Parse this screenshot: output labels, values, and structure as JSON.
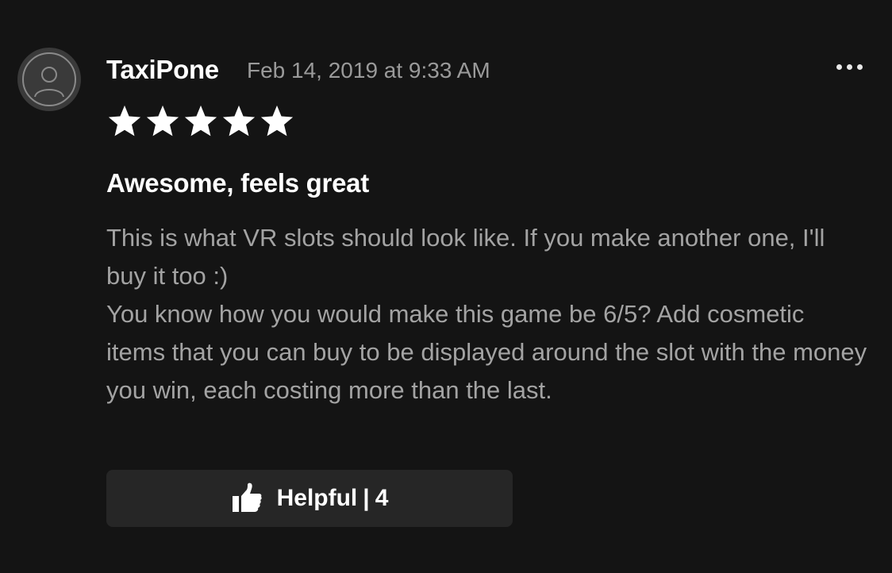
{
  "review": {
    "author": "TaxiPone",
    "timestamp": "Feb 14, 2019 at 9:33 AM",
    "rating": 5,
    "rating_max": 5,
    "title": "Awesome, feels great",
    "body": "This is what VR slots should look like. If you make another one, I'll buy it too :)\nYou know how you would make this game be 6/5? Add cosmetic items that you can buy to be displayed around the slot with the money you win, each costing more than the last."
  },
  "actions": {
    "more_icon": "more-horizontal-icon",
    "helpful_icon": "thumbs-up-icon",
    "helpful_label": "Helpful",
    "helpful_separator": "|",
    "helpful_count": "4"
  },
  "colors": {
    "background": "#141414",
    "button_background": "#262626",
    "body_text": "#a3a3a3",
    "timestamp_text": "#9a9a9a",
    "star": "#ffffff"
  }
}
